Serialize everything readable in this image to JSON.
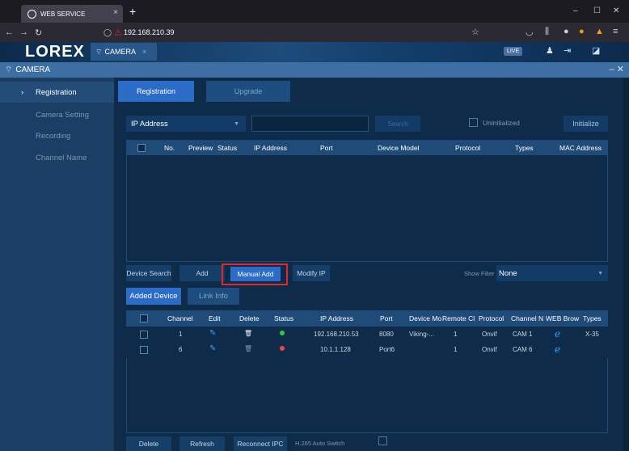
{
  "browser": {
    "tab_title": "WEB SERVICE",
    "new_tab": "+",
    "url": "192.168.210.39"
  },
  "app": {
    "logo": "LOREX",
    "header_tab": "CAMERA",
    "live_badge": "LIVE"
  },
  "section": {
    "title": "CAMERA"
  },
  "sidebar": {
    "items": [
      {
        "label": "Registration"
      },
      {
        "label": "Camera Setting"
      },
      {
        "label": "Recording"
      },
      {
        "label": "Channel Name"
      }
    ]
  },
  "tabs": {
    "registration": "Registration",
    "upgrade": "Upgrade"
  },
  "search": {
    "type_value": "IP Address",
    "search_button": "Search",
    "uninitialized_label": "Uninitialized",
    "initialize_button": "Initialize"
  },
  "search_table": {
    "columns": [
      "No.",
      "Preview",
      "Status",
      "IP Address",
      "Port",
      "Device Model",
      "Protocol",
      "Types",
      "MAC Address"
    ]
  },
  "actions": {
    "device_search": "Device Search",
    "add": "Add",
    "manual_add": "Manual Add",
    "modify_ip": "Modify IP",
    "show_filter_label": "Show Filter",
    "show_filter_value": "None"
  },
  "device_tabs": {
    "added_device": "Added Device",
    "link_info": "Link Info"
  },
  "added_table": {
    "columns": [
      "Channel",
      "Edit",
      "Delete",
      "Status",
      "IP Address",
      "Port",
      "Device Mo",
      "Remote Cl",
      "Protocol",
      "Channel N",
      "WEB Brow",
      "Types"
    ],
    "rows": [
      {
        "channel": "1",
        "status_color": "#2ecc40",
        "ip": "192.168.210.53",
        "port": "8080",
        "device_model": "Viking-...",
        "remote_ch": "1",
        "protocol": "Onvif",
        "channel_name": "CAM 1",
        "types": "X-35"
      },
      {
        "channel": "6",
        "status_color": "#e74c3c",
        "ip": "10.1.1.128",
        "port": "Port6",
        "device_model": "",
        "remote_ch": "1",
        "protocol": "Onvif",
        "channel_name": "CAM 6",
        "types": ""
      }
    ]
  },
  "bottom": {
    "delete": "Delete",
    "refresh": "Refresh",
    "reconnect": "Reconnect IPC",
    "h265_label": "H.265 Auto Switch"
  },
  "colors": {
    "accent": "#2a6cc7",
    "highlight": "#e5262a",
    "status_online": "#2ecc40",
    "status_offline": "#e74c3c"
  }
}
